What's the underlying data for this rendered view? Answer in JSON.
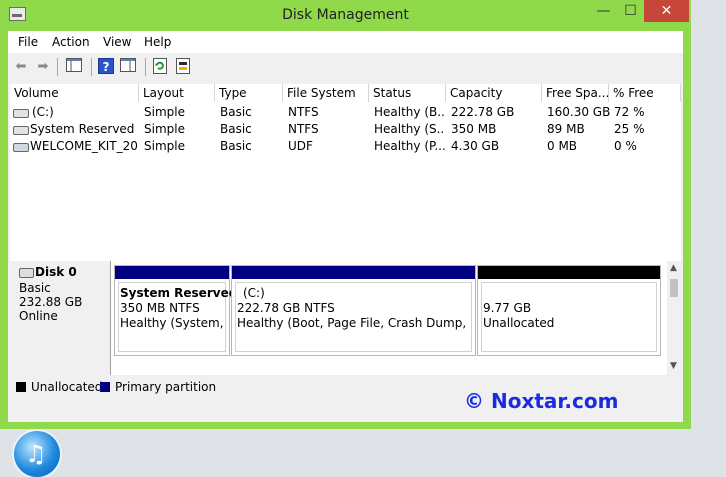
{
  "window": {
    "title": "Disk Management",
    "minimize": "—",
    "maximize": "☐",
    "close": "✕"
  },
  "menu": [
    "File",
    "Action",
    "View",
    "Help"
  ],
  "toolbar": {
    "icons": [
      "back-arrow-icon",
      "forward-arrow-icon",
      "show-hide-console-tree-icon",
      "help-icon",
      "show-hide-action-pane-icon",
      "refresh-icon",
      "rescan-disks-icon"
    ]
  },
  "volumes": {
    "columns": [
      "Volume",
      "Layout",
      "Type",
      "File System",
      "Status",
      "Capacity",
      "Free Spa...",
      "% Free"
    ],
    "rows": [
      {
        "volume": "(C:)",
        "layout": "Simple",
        "type": "Basic",
        "fs": "NTFS",
        "status": "Healthy (B...",
        "capacity": "222.78 GB",
        "free": "160.30 GB",
        "pct": "72 %"
      },
      {
        "volume": "System Reserved",
        "layout": "Simple",
        "type": "Basic",
        "fs": "NTFS",
        "status": "Healthy (S...",
        "capacity": "350 MB",
        "free": "89 MB",
        "pct": "25 %"
      },
      {
        "volume": "WELCOME_KIT_20...",
        "layout": "Simple",
        "type": "Basic",
        "fs": "UDF",
        "status": "Healthy (P...",
        "capacity": "4.30 GB",
        "free": "0 MB",
        "pct": "0 %"
      }
    ]
  },
  "disk": {
    "name": "Disk 0",
    "kind": "Basic",
    "size": "232.88 GB",
    "state": "Online",
    "partitions": [
      {
        "title": "System Reserved",
        "detail": "350 MB NTFS",
        "status": "Healthy (System, A",
        "bar_color": "#000080"
      },
      {
        "title": "(C:)",
        "detail": "222.78 GB NTFS",
        "status": "Healthy (Boot, Page File, Crash Dump, Prim",
        "bar_color": "#000080"
      },
      {
        "title": "",
        "detail": "9.77 GB",
        "status": "Unallocated",
        "bar_color": "#000000"
      }
    ]
  },
  "legend": {
    "unallocated": "Unallocated",
    "primary": "Primary partition",
    "unallocated_color": "#000000",
    "primary_color": "#000080"
  },
  "watermark": "© Noxtar.com",
  "desktop": {
    "icon": "itunes-icon"
  }
}
